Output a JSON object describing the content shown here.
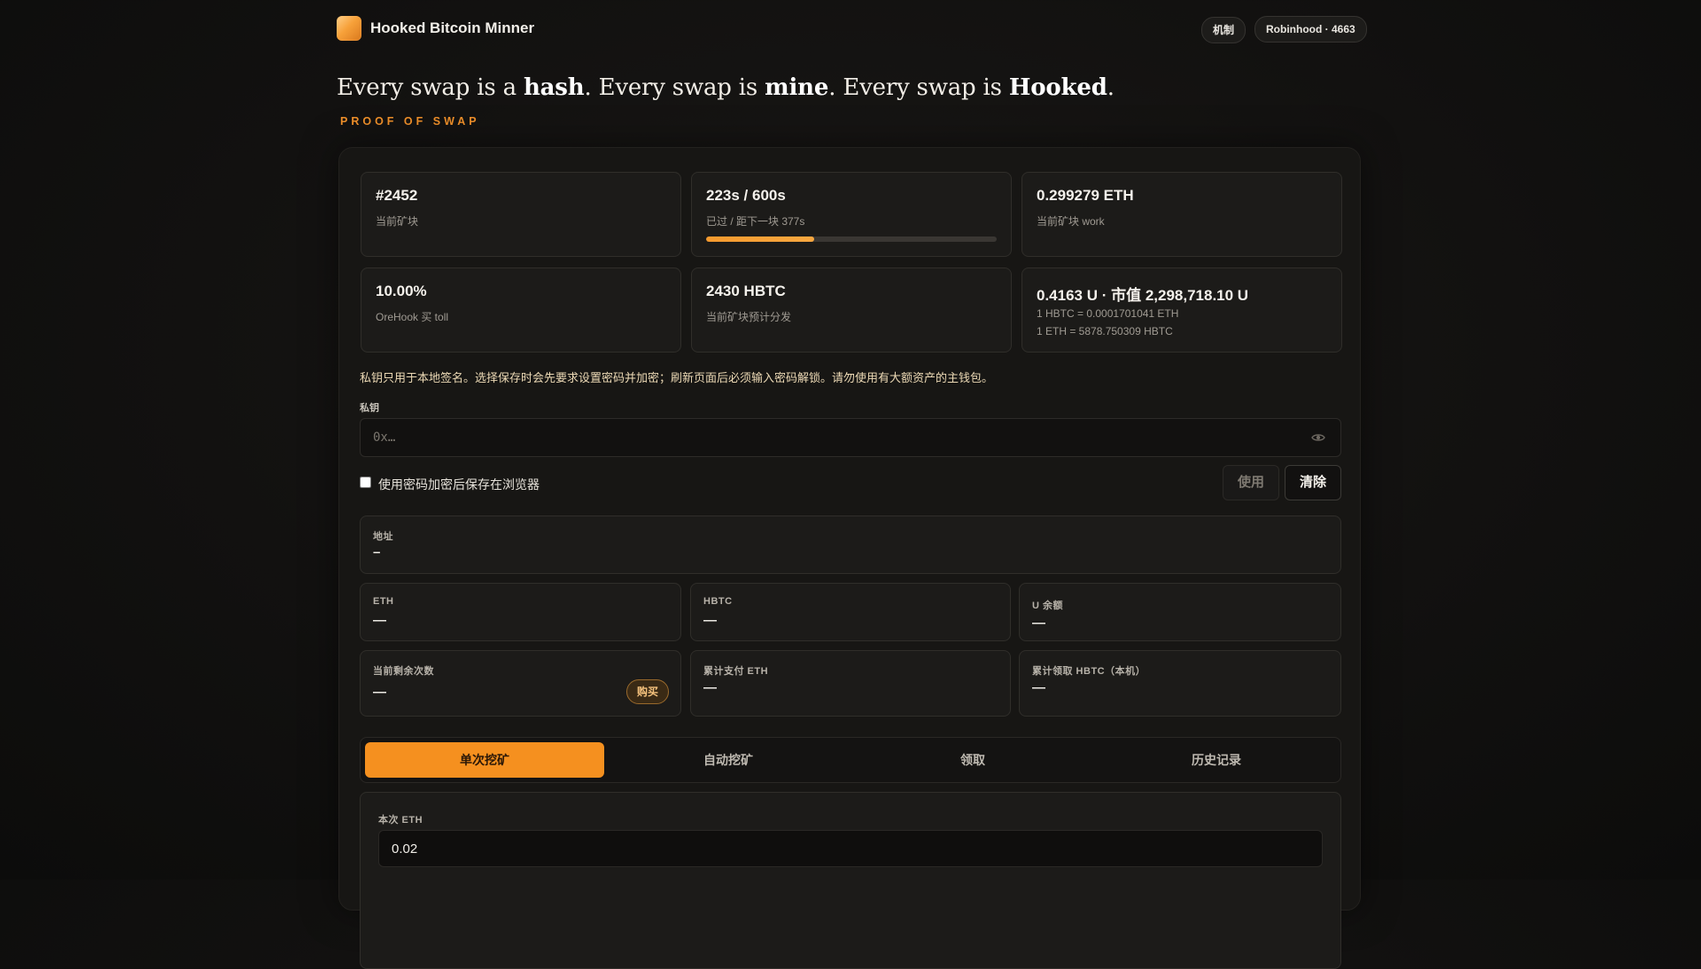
{
  "header": {
    "brand": "Hooked Bitcoin Minner",
    "mechanism_label": "机制",
    "wallet_label": "Robinhood · 4663"
  },
  "hero": {
    "p1": "Every swap is a ",
    "w1": "hash",
    "p2": ". Every swap is ",
    "w2": "mine",
    "p3": ". Every swap is ",
    "w3": "Hooked",
    "p4": ".",
    "tagline": "PROOF OF SWAP"
  },
  "stats": {
    "block": {
      "value": "#2452",
      "label": "当前矿块"
    },
    "timer": {
      "value": "223s / 600s",
      "label": "已过 / 距下一块 377s",
      "progress_fraction": 0.372
    },
    "work": {
      "value": "0.299279 ETH",
      "label": "当前矿块 work"
    },
    "toll": {
      "value": "10.00%",
      "label": "OreHook 买 toll"
    },
    "distribution": {
      "value": "2430 HBTC",
      "label": "当前矿块预计分发"
    },
    "price": {
      "value": "0.4163 U · 市值 2,298,718.10 U",
      "line1": "1 HBTC = 0.0001701041 ETH",
      "line2": "1 ETH = 5878.750309 HBTC"
    }
  },
  "key": {
    "warning": "私钥只用于本地签名。选择保存时会先要求设置密码并加密；刷新页面后必须输入密码解锁。请勿使用有大额资产的主钱包。",
    "label": "私钥",
    "placeholder": "0x…",
    "value": "",
    "save_label": "使用密码加密后保存在浏览器",
    "use_label": "使用",
    "clear_label": "清除"
  },
  "account": {
    "address_label": "地址",
    "address_value": "–",
    "eth_label": "ETH",
    "eth_value": "—",
    "hbtc_label": "HBTC",
    "hbtc_value": "—",
    "u_label": "U 余额",
    "u_value": "—",
    "remaining_label": "当前剩余次数",
    "remaining_value": "—",
    "buy_label": "购买",
    "paid_label": "累计支付 ETH",
    "paid_value": "—",
    "claimed_label": "累计领取 HBTC（本机）",
    "claimed_value": "—"
  },
  "tabs": [
    {
      "label": "单次挖矿",
      "active": true
    },
    {
      "label": "自动挖矿",
      "active": false
    },
    {
      "label": "领取",
      "active": false
    },
    {
      "label": "历史记录",
      "active": false
    }
  ],
  "mine": {
    "amount_label": "本次 ETH",
    "amount_value": "0.02"
  },
  "colors": {
    "accent": "#f5901f",
    "background": "#121110",
    "card": "#1c1b19"
  }
}
